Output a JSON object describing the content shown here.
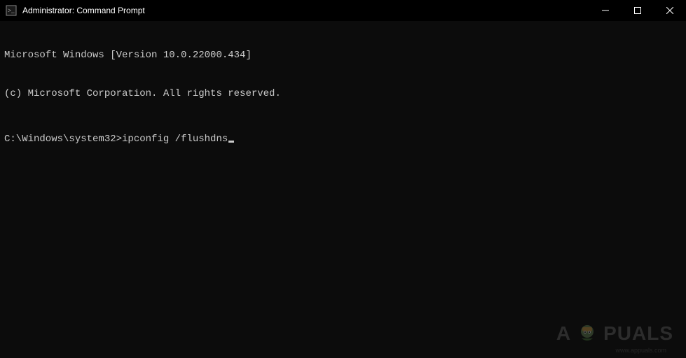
{
  "titlebar": {
    "title": "Administrator: Command Prompt"
  },
  "terminal": {
    "line1": "Microsoft Windows [Version 10.0.22000.434]",
    "line2": "(c) Microsoft Corporation. All rights reserved.",
    "prompt": "C:\\Windows\\system32>",
    "command": "ipconfig /flushdns"
  },
  "watermark": {
    "left": "A",
    "right": "PUALS",
    "sub": "www.appuals.com"
  }
}
